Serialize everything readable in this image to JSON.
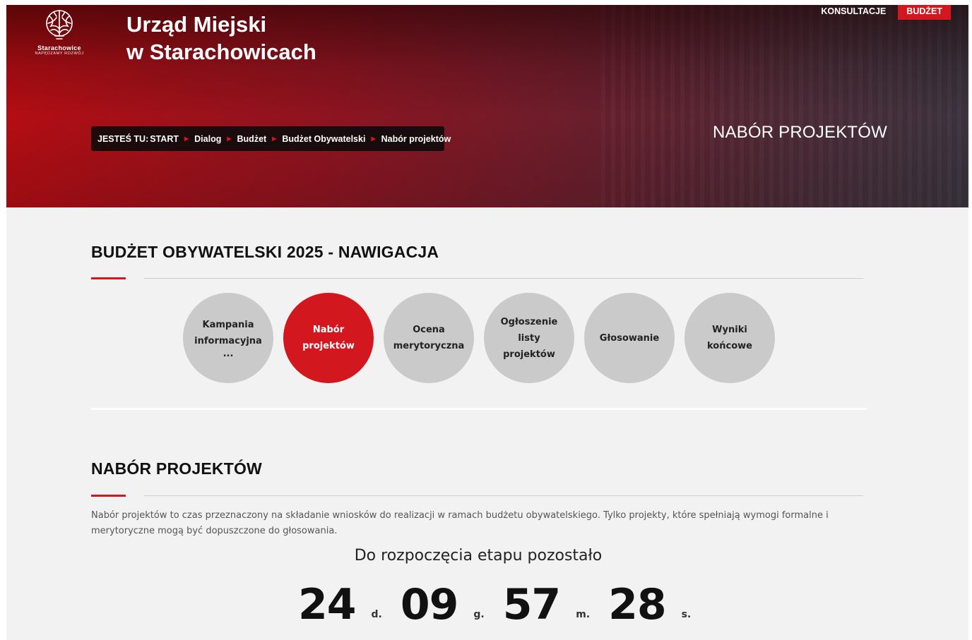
{
  "brand": {
    "logo_name": "Starachowice",
    "logo_tagline": "NAPĘDZAMY ROZWÓJ",
    "title_line1": "Urząd Miejski",
    "title_line2": "w Starachowicach"
  },
  "topnav": {
    "consultations": "KONSULTACJE",
    "budget": "BUDŻET"
  },
  "breadcrumb": {
    "prefix": "JESTEŚ TU:",
    "items": [
      "START",
      "Dialog",
      "Budżet",
      "Budżet Obywatelski",
      "Nabór projektów"
    ]
  },
  "hero": {
    "heading": "NABÓR PROJEKTÓW"
  },
  "nav_section": {
    "title": "BUDŻET OBYWATELSKI 2025 - NAWIGACJA",
    "steps": [
      {
        "line1": "Kampania",
        "line2": "informacyjna",
        "line3": "...",
        "active": false
      },
      {
        "line1": "Nabór",
        "line2": "projektów",
        "line3": "",
        "active": true
      },
      {
        "line1": "Ocena",
        "line2": "merytoryczna",
        "line3": "",
        "active": false
      },
      {
        "line1": "Ogłoszenie listy",
        "line2": "projektów",
        "line3": "",
        "active": false
      },
      {
        "line1": "Głosowanie",
        "line2": "",
        "line3": "",
        "active": false
      },
      {
        "line1": "Wyniki końcowe",
        "line2": "",
        "line3": "",
        "active": false
      }
    ]
  },
  "content": {
    "title": "NABÓR PROJEKTÓW",
    "description": "Nabór projektów to czas przeznaczony na składanie wniosków do realizacji w ramach budżetu obywatelskiego. Tylko projekty, które spełniają wymogi formalne i merytoryczne mogą być dopuszczone do głosowania.",
    "countdown_label": "Do rozpoczęcia etapu pozostało",
    "countdown": {
      "days": "24",
      "days_unit": "d.",
      "hours": "09",
      "hours_unit": "g.",
      "minutes": "57",
      "minutes_unit": "m.",
      "seconds": "28",
      "seconds_unit": "s."
    }
  },
  "colors": {
    "accent": "#d3171e",
    "step_inactive": "#cacaca",
    "page_bg": "#f2f2f2"
  },
  "icons": {
    "logo": "starachowice-logo-icon",
    "breadcrumb_separator": "triangle-right-icon"
  }
}
